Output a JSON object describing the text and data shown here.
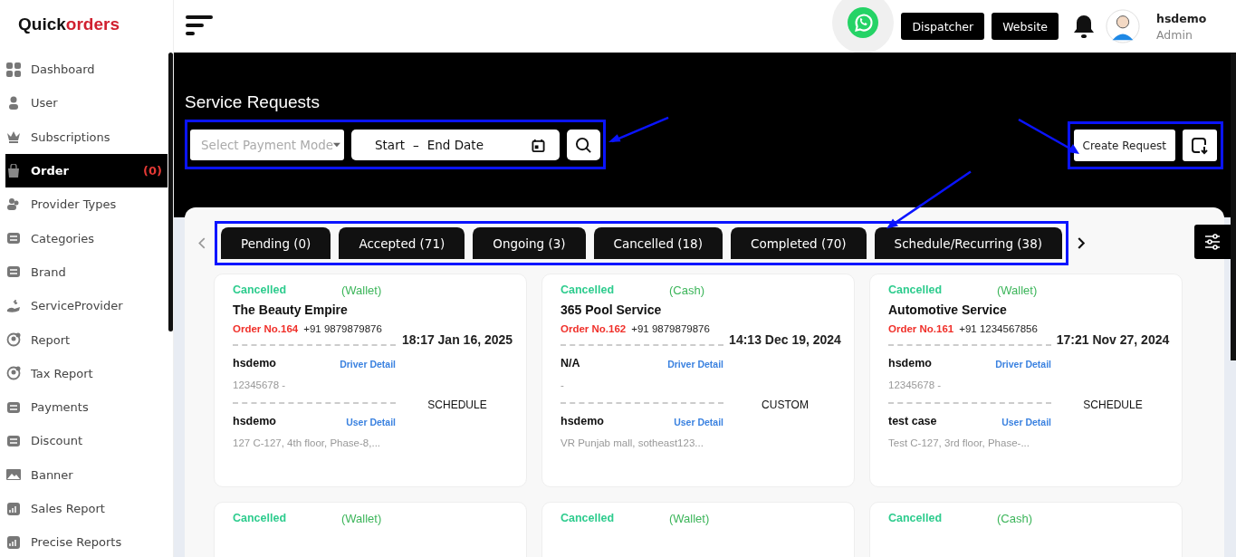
{
  "logo": {
    "first": "Quick",
    "second": "orders"
  },
  "sidebar": {
    "items": [
      {
        "label": "Dashboard",
        "selected": false
      },
      {
        "label": "User",
        "selected": false
      },
      {
        "label": "Subscriptions",
        "selected": false
      },
      {
        "label": "Order",
        "selected": true,
        "badge": "(0)"
      },
      {
        "label": "Provider Types",
        "selected": false
      },
      {
        "label": "Categories",
        "selected": false
      },
      {
        "label": "Brand",
        "selected": false
      },
      {
        "label": "ServiceProvider",
        "selected": false
      },
      {
        "label": "Report",
        "selected": false
      },
      {
        "label": "Tax Report",
        "selected": false
      },
      {
        "label": "Payments",
        "selected": false
      },
      {
        "label": "Discount",
        "selected": false
      },
      {
        "label": "Banner",
        "selected": false
      },
      {
        "label": "Sales Report",
        "selected": false
      },
      {
        "label": "Precise Reports",
        "selected": false
      }
    ]
  },
  "header": {
    "buttons": [
      "Dispatcher",
      "Website"
    ],
    "user": {
      "name": "hsdemo",
      "role": "Admin"
    }
  },
  "page_title": "Service Requests",
  "filters": {
    "payment_mode": {
      "placeholder": "Select Payment Mode"
    },
    "date_range": {
      "start": "Start",
      "separator": "–",
      "end": "End Date"
    }
  },
  "create_button": "Create Request",
  "tabs": [
    {
      "label": "Pending (0)",
      "selected": false
    },
    {
      "label": "Accepted (71)",
      "selected": false
    },
    {
      "label": "Ongoing (3)",
      "selected": false
    },
    {
      "label": "Cancelled (18)",
      "selected": false
    },
    {
      "label": "Completed (70)",
      "selected": false
    },
    {
      "label": "Schedule/Recurring (38)",
      "selected": false
    }
  ],
  "cards": [
    {
      "status": "Cancelled",
      "payment": "(Wallet)",
      "name": "The Beauty Empire",
      "order_no": "Order No.164",
      "phone": "+91 9879879876",
      "datetime": "18:17 Jan 16, 2025",
      "driver_name": "hsdemo",
      "driver_link": "Driver Detail",
      "driver_info": "12345678 -",
      "user_name": "hsdemo",
      "user_link": "User Detail",
      "address": "127 C-127, 4th floor, Phase-8,...",
      "type": "SCHEDULE"
    },
    {
      "status": "Cancelled",
      "payment": "(Cash)",
      "name": "365 Pool Service",
      "order_no": "Order No.162",
      "phone": "+91 9879879876",
      "datetime": "14:13 Dec 19, 2024",
      "driver_name": "N/A",
      "driver_link": "Driver Detail",
      "driver_info": "-",
      "user_name": "hsdemo",
      "user_link": "User Detail",
      "address": "VR Punjab mall, sotheast123...",
      "type": "CUSTOM"
    },
    {
      "status": "Cancelled",
      "payment": "(Wallet)",
      "name": "Automotive Service",
      "order_no": "Order No.161",
      "phone": "+91 1234567856",
      "datetime": "17:21 Nov 27, 2024",
      "driver_name": "hsdemo",
      "driver_link": "Driver Detail",
      "driver_info": "12345678 -",
      "user_name": "test case",
      "user_link": "User Detail",
      "address": "Test C-127, 3rd floor, Phase-...",
      "type": "SCHEDULE"
    },
    {
      "status": "Cancelled",
      "payment": "(Wallet)"
    },
    {
      "status": "Cancelled",
      "payment": "(Wallet)"
    },
    {
      "status": "Cancelled",
      "payment": "(Cash)"
    }
  ]
}
